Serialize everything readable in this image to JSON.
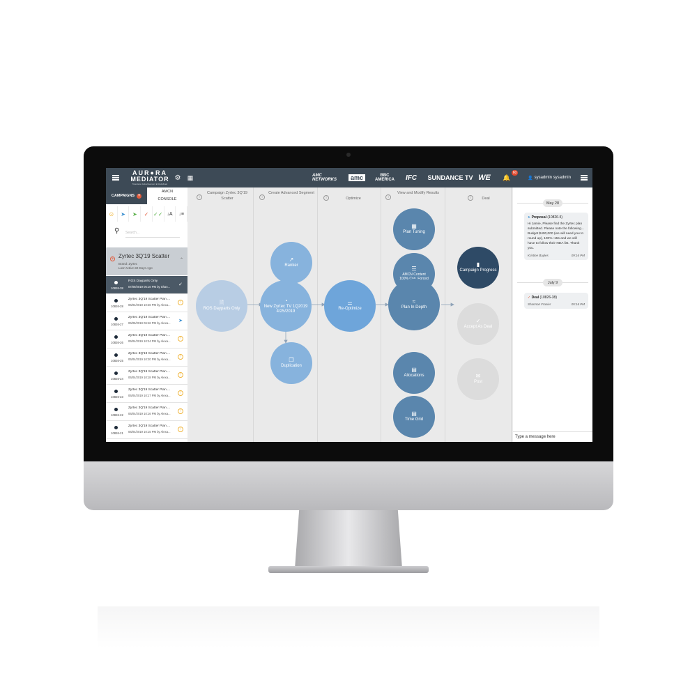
{
  "topbar": {
    "logo_line1": "AUR●RA",
    "logo_line2": "MEDIATOR",
    "logo_tagline": "Television Advertisement ● Redefined",
    "networks": [
      "AMC NETWORKS",
      "amc",
      "BBC AMERICA",
      "IFC",
      "SUNDANCE TV",
      "WE"
    ],
    "notification_count": "60",
    "user": "sysadmin sysadmin"
  },
  "sidebar": {
    "tab_campaigns": "CAMPAIGNS",
    "tab_console_line1": "AMCN",
    "tab_console_line2": "CONSOLE",
    "search_placeholder": "Search...",
    "group": {
      "title": "Zyrtec 3Q'19 Scatter",
      "brand": "Brand: Zyrtec",
      "last_active": "Last Active 60 Days Ago"
    },
    "rows": [
      {
        "id": "10826-38",
        "title": "ROS Dayparts Only",
        "sub": "07/09/2019 05:16 PM by Shan...",
        "status": "✓"
      },
      {
        "id": "10826-28",
        "title": "Zyrtec 3Q'19 Scatter Plan ...",
        "sub": "06/04/2019 10:26 PM by Alexa...",
        "status": "!"
      },
      {
        "id": "10826-27",
        "title": "Zyrtec 3Q'19 Scatter Plan ...",
        "sub": "06/05/2019 06:46 PM by Alexa...",
        "status": "➤"
      },
      {
        "id": "10826-26",
        "title": "Zyrtec 3Q'19 Scatter Plan ...",
        "sub": "06/04/2019 10:24 PM by Alexa...",
        "status": "!"
      },
      {
        "id": "10826-25",
        "title": "Zyrtec 3Q'19 Scatter Plan ...",
        "sub": "06/04/2019 10:20 PM by Alexa...",
        "status": "!"
      },
      {
        "id": "10826-24",
        "title": "Zyrtec 3Q'19 Scatter Plan ...",
        "sub": "06/04/2019 10:18 PM by Alexa...",
        "status": "!"
      },
      {
        "id": "10826-23",
        "title": "Zyrtec 3Q'19 Scatter Plan ...",
        "sub": "06/04/2019 10:17 PM by Alexa...",
        "status": "!"
      },
      {
        "id": "10826-22",
        "title": "Zyrtec 3Q'19 Scatter Plan ...",
        "sub": "06/04/2019 10:16 PM by Alexa...",
        "status": "!"
      },
      {
        "id": "10826-21",
        "title": "Zyrtec 3Q'19 Scatter Plan ...",
        "sub": "06/04/2019 10:15 PM by Alexa...",
        "status": "!"
      }
    ]
  },
  "workflow": {
    "columns": [
      "Campaign Zyrtec 3Q'19 Scatter",
      "Create Advanced Segment",
      "Optimize",
      "View and Modify Results",
      "Deal"
    ],
    "nodes": {
      "ros": "ROS Dayparts Only",
      "ranker": "Ranker",
      "new_plan": "New Zyrtec TV 1Q2019 4/25/2019",
      "duplication": "Duplication",
      "reoptimize": "Re-Optimize",
      "plan_tuning": "Plan Tuning",
      "amcn_content": "AMCN Content 100% Con. Forced",
      "plan_in_depth": "Plan In Depth",
      "allocations": "Allocations",
      "time_grid": "Time Grid",
      "campaign_progress": "Campaign Progress",
      "accept_as_deal": "Accept As Deal",
      "post": "Post"
    }
  },
  "chat": {
    "date1": "May 28",
    "msg1_title": "Proposal",
    "msg1_id": "(10826-5)",
    "msg1_body": "Hi Jamie, Please find the Zyrtec plan submitted. Please note the following... Budget $400,000 (we will need you to round up), 100% :15s and we will have to follow their NDA list. Thank you.",
    "msg1_author": "Kristine Bayles",
    "msg1_time": "09:16 PM",
    "date2": "July 9",
    "msg2_title": "Deal",
    "msg2_id": "(10826-38)",
    "msg2_author": "Shannon Frasier",
    "msg2_time": "05:16 PM",
    "input_placeholder": "Type a message here"
  },
  "colors": {
    "topbar": "#3d4a56",
    "node_light": "#b8cde4",
    "node_mid": "#87b3dd",
    "node_blue": "#6ea5da",
    "node_dark": "#5a86ad",
    "node_navy": "#2e4a66",
    "node_disabled": "#dcdcdc",
    "pending": "#f0b53a"
  }
}
